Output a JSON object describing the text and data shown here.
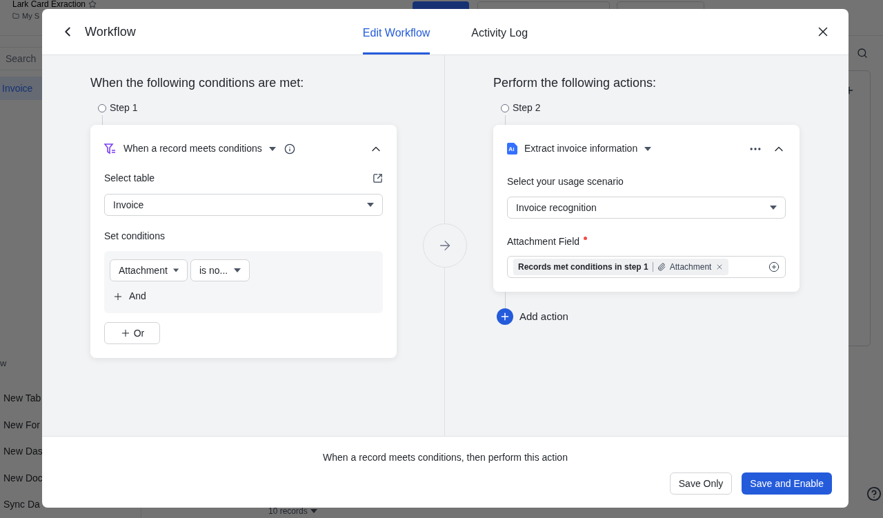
{
  "background": {
    "app_title": "Lark Card Exraction",
    "breadcrumb": "My S",
    "search_placeholder": "Search",
    "sidebar_items": [
      {
        "label": "Invoice",
        "selected": true
      }
    ],
    "section_label": "w",
    "create_items": [
      "New Tab",
      "New For",
      "New Das",
      "New Doc",
      "Sync Da"
    ],
    "records_count": "10 records"
  },
  "modal": {
    "title": "Workflow",
    "tabs": [
      {
        "label": "Edit Workflow",
        "selected": true
      },
      {
        "label": "Activity Log",
        "selected": false
      }
    ],
    "conditions_panel": {
      "heading": "When the following conditions are met:",
      "step": "Step 1",
      "trigger": {
        "title": "When a record meets conditions",
        "expanded": true,
        "table_label": "Select table",
        "table_value": "Invoice",
        "conditions_label": "Set conditions",
        "condition": {
          "field": "Attachment",
          "operator": "is no..."
        },
        "and_label": "And",
        "or_label": "Or"
      }
    },
    "actions_panel": {
      "heading": "Perform the following actions:",
      "step": "Step 2",
      "action": {
        "title": "Extract invoice information",
        "expanded": true,
        "scenario_label": "Select your usage scenario",
        "scenario_value": "Invoice recognition",
        "field_label": "Attachment Field",
        "required": true,
        "field_source": "Records met conditions in step 1",
        "field_name": "Attachment"
      },
      "add_label": "Add action"
    },
    "footer_text": "When a record meets conditions, then perform this action",
    "buttons": [
      {
        "label": "Save Only",
        "kind": "secondary"
      },
      {
        "label": "Save and Enable",
        "kind": "primary"
      }
    ]
  }
}
